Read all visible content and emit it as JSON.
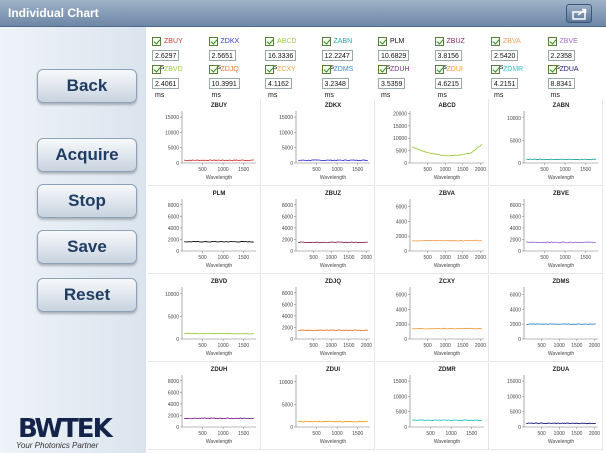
{
  "window": {
    "title": "Individual Chart"
  },
  "toolbar": {
    "export_icon": "export-icon"
  },
  "sidebar": {
    "buttons": [
      {
        "label": "Back"
      },
      {
        "label": "Acquire"
      },
      {
        "label": "Stop"
      },
      {
        "label": "Save"
      },
      {
        "label": "Reset"
      }
    ],
    "logo": {
      "brand": "BWTEK",
      "tagline": "Your Photonics Partner"
    }
  },
  "legend": {
    "row1": [
      {
        "name": "ZBUY",
        "color": "#d43a3a",
        "value": "2.6297 ms"
      },
      {
        "name": "ZDKX",
        "color": "#3a3ad4",
        "value": "2.5651 ms"
      },
      {
        "name": "ABCD",
        "color": "#9ccc3a",
        "value": "16.3336 ms"
      },
      {
        "name": "ZABN",
        "color": "#26a7a7",
        "value": "12.2247 ms"
      },
      {
        "name": "PLM",
        "color": "#111111",
        "value": "10.6829 ms"
      },
      {
        "name": "ZBUZ",
        "color": "#8c2c5a",
        "value": "3.8156 ms"
      },
      {
        "name": "ZBVA",
        "color": "#f5a25a",
        "value": "2.5420 ms"
      },
      {
        "name": "ZBVE",
        "color": "#a56ad8",
        "value": "2.2358 ms"
      }
    ],
    "row2": [
      {
        "name": "ZBVD",
        "color": "#9ccc3a",
        "value": "2.4061 ms"
      },
      {
        "name": "ZDJQ",
        "color": "#e9772a",
        "value": "10.3991 ms"
      },
      {
        "name": "ZCXY",
        "color": "#f0a04a",
        "value": "4.1162 ms"
      },
      {
        "name": "ZDMS",
        "color": "#3a8ad4",
        "value": "3.2348 ms"
      },
      {
        "name": "ZDUH",
        "color": "#7a2c8a",
        "value": "3.5359 ms"
      },
      {
        "name": "ZDUI",
        "color": "#f0a020",
        "value": "4.6215 ms"
      },
      {
        "name": "ZDMR",
        "color": "#2ec4c4",
        "value": "4.2151 ms"
      },
      {
        "name": "ZDUA",
        "color": "#1a1a7a",
        "value": "8.8341 ms"
      }
    ]
  },
  "chart_data": [
    {
      "type": "line",
      "title": "ZBUY",
      "xlabel": "Wavelength",
      "xlim": [
        0,
        1800
      ],
      "xticks": [
        500,
        1000,
        1500
      ],
      "yticks": [
        0,
        5000,
        10000,
        15000
      ],
      "ylim": [
        0,
        17000
      ],
      "color": "#d43a3a",
      "baseline": 900
    },
    {
      "type": "line",
      "title": "ZDKX",
      "xlabel": "Wavelength",
      "xlim": [
        0,
        1800
      ],
      "xticks": [
        500,
        1000,
        1500
      ],
      "yticks": [
        0,
        5000,
        10000,
        15000
      ],
      "ylim": [
        0,
        17000
      ],
      "color": "#3a3ad4",
      "baseline": 900
    },
    {
      "type": "line",
      "title": "ABCD",
      "xlabel": "Wavelength",
      "xlim": [
        0,
        2100
      ],
      "xticks": [
        500,
        1000,
        1500,
        2000
      ],
      "yticks": [
        0,
        5000,
        10000,
        15000,
        20000
      ],
      "ylim": [
        0,
        21000
      ],
      "color": "#9ccc3a",
      "baseline": 3000,
      "curve": "bowl"
    },
    {
      "type": "line",
      "title": "ZABN",
      "xlabel": "Wavelength",
      "xlim": [
        0,
        1800
      ],
      "xticks": [
        500,
        1000,
        1500
      ],
      "yticks": [
        0,
        5000,
        10000
      ],
      "ylim": [
        0,
        11500
      ],
      "color": "#26a7a7",
      "baseline": 800
    },
    {
      "type": "line",
      "title": "PLM",
      "xlabel": "Wavelength",
      "xlim": [
        0,
        1800
      ],
      "xticks": [
        500,
        1000,
        1500
      ],
      "yticks": [
        0,
        2000,
        4000,
        6000,
        8000
      ],
      "ylim": [
        0,
        9000
      ],
      "color": "#111111",
      "baseline": 1600
    },
    {
      "type": "line",
      "title": "ZBUZ",
      "xlabel": "Wavelength",
      "xlim": [
        0,
        2100
      ],
      "xticks": [
        500,
        1000,
        1500,
        2000
      ],
      "yticks": [
        0,
        2000,
        4000,
        6000,
        8000
      ],
      "ylim": [
        0,
        9000
      ],
      "color": "#8c2c5a",
      "baseline": 1500
    },
    {
      "type": "line",
      "title": "ZBVA",
      "xlabel": "Wavelength",
      "xlim": [
        0,
        2100
      ],
      "xticks": [
        500,
        1000,
        1500,
        2000
      ],
      "yticks": [
        0,
        2000,
        4000,
        6000
      ],
      "ylim": [
        0,
        7000
      ],
      "color": "#f5a25a",
      "baseline": 1400
    },
    {
      "type": "line",
      "title": "ZBVE",
      "xlabel": "Wavelength",
      "xlim": [
        0,
        1800
      ],
      "xticks": [
        500,
        1000,
        1500
      ],
      "yticks": [
        0,
        2000,
        4000,
        6000,
        8000
      ],
      "ylim": [
        0,
        9000
      ],
      "color": "#a56ad8",
      "baseline": 1500
    },
    {
      "type": "line",
      "title": "ZBVD",
      "xlabel": "Wavelength",
      "xlim": [
        0,
        1800
      ],
      "xticks": [
        500,
        1000,
        1500
      ],
      "yticks": [
        0,
        5000,
        10000
      ],
      "ylim": [
        0,
        11500
      ],
      "color": "#9ccc3a",
      "baseline": 1200
    },
    {
      "type": "line",
      "title": "ZDJQ",
      "xlabel": "Wavelength",
      "xlim": [
        0,
        2100
      ],
      "xticks": [
        500,
        1000,
        1500,
        2000
      ],
      "yticks": [
        0,
        2000,
        4000,
        6000,
        8000
      ],
      "ylim": [
        0,
        9000
      ],
      "color": "#e9772a",
      "baseline": 1500
    },
    {
      "type": "line",
      "title": "ZCXY",
      "xlabel": "Wavelength",
      "xlim": [
        0,
        2100
      ],
      "xticks": [
        500,
        1000,
        1500,
        2000
      ],
      "yticks": [
        0,
        2000,
        4000,
        6000
      ],
      "ylim": [
        0,
        7000
      ],
      "color": "#f0a04a",
      "baseline": 1400
    },
    {
      "type": "line",
      "title": "ZDMS",
      "xlabel": "Wavelength",
      "xlim": [
        0,
        2100
      ],
      "xticks": [
        500,
        1000,
        1500,
        2000
      ],
      "yticks": [
        0,
        2000,
        4000,
        6000
      ],
      "ylim": [
        0,
        7000
      ],
      "color": "#3a8ad4",
      "baseline": 2000
    },
    {
      "type": "line",
      "title": "ZDUH",
      "xlabel": "Wavelength",
      "xlim": [
        0,
        1800
      ],
      "xticks": [
        500,
        1000,
        1500
      ],
      "yticks": [
        0,
        2000,
        4000,
        6000,
        8000
      ],
      "ylim": [
        0,
        9000
      ],
      "color": "#7a2c8a",
      "baseline": 1500
    },
    {
      "type": "line",
      "title": "ZDUI",
      "xlabel": "Wavelength",
      "xlim": [
        0,
        1800
      ],
      "xticks": [
        500,
        1000,
        1500
      ],
      "yticks": [
        0,
        5000,
        10000
      ],
      "ylim": [
        0,
        11500
      ],
      "color": "#f0a020",
      "baseline": 1200
    },
    {
      "type": "line",
      "title": "ZDMR",
      "xlabel": "Wavelength",
      "xlim": [
        0,
        1800
      ],
      "xticks": [
        500,
        1000,
        1500
      ],
      "yticks": [
        0,
        5000,
        10000,
        15000
      ],
      "ylim": [
        0,
        17000
      ],
      "color": "#2ec4c4",
      "baseline": 2200
    },
    {
      "type": "line",
      "title": "ZDUA",
      "xlabel": "Wavelength",
      "xlim": [
        0,
        2100
      ],
      "xticks": [
        500,
        1000,
        1500,
        2000
      ],
      "yticks": [
        0,
        5000,
        10000,
        15000
      ],
      "ylim": [
        0,
        17000
      ],
      "color": "#1a1a7a",
      "baseline": 1200
    }
  ]
}
